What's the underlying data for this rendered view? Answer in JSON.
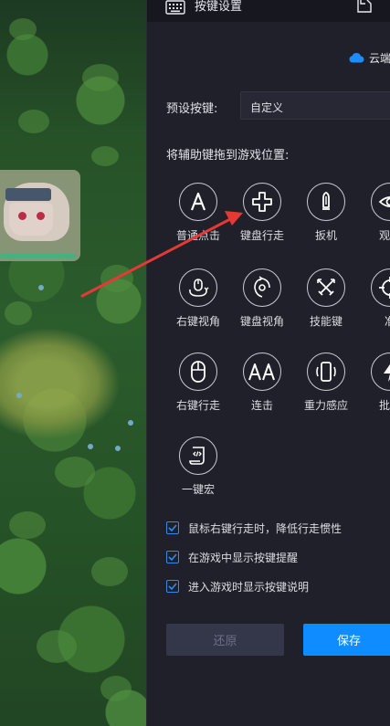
{
  "window": {
    "title": "按键设置",
    "title_icon": "keyboard-icon",
    "doc_icon": "document-icon"
  },
  "cloud": {
    "icon": "cloud-icon",
    "label": "云端",
    "accent": "#1e8bff"
  },
  "preset": {
    "label": "预设按键:",
    "value": "自定义"
  },
  "drag_hint": "将辅助键拖到游戏位置:",
  "keys": [
    {
      "label": "普通点击",
      "icon": "letter-a-icon"
    },
    {
      "label": "键盘行走",
      "icon": "dpad-cross-icon"
    },
    {
      "label": "扳机",
      "icon": "trigger-bullet-icon"
    },
    {
      "label": "观察",
      "icon": "eye-icon"
    },
    {
      "label": "右键视角",
      "icon": "mouse-rotate-icon"
    },
    {
      "label": "键盘视角",
      "icon": "rotate-view-icon"
    },
    {
      "label": "技能键",
      "icon": "crossed-swords-icon"
    },
    {
      "label": "准",
      "icon": "crosshair-icon"
    },
    {
      "label": "右键行走",
      "icon": "mouse-icon"
    },
    {
      "label": "连击",
      "icon": "double-a-icon"
    },
    {
      "label": "重力感应",
      "icon": "phone-tilt-icon"
    },
    {
      "label": "批量",
      "icon": "lightning-icon"
    },
    {
      "label": "一键宏",
      "icon": "script-icon"
    }
  ],
  "options": [
    {
      "label": "鼠标右键行走时，降低行走惯性",
      "checked": true
    },
    {
      "label": "在游戏中显示按键提醒",
      "checked": true
    },
    {
      "label": "进入游戏时显示按键说明",
      "checked": true
    }
  ],
  "buttons": {
    "restore": "还原",
    "save": "保存"
  },
  "colors": {
    "panel_bg": "#1f2029",
    "accent_blue": "#0f8cff",
    "annotation_arrow": "#e53935",
    "disabled_button": "#34374a"
  }
}
